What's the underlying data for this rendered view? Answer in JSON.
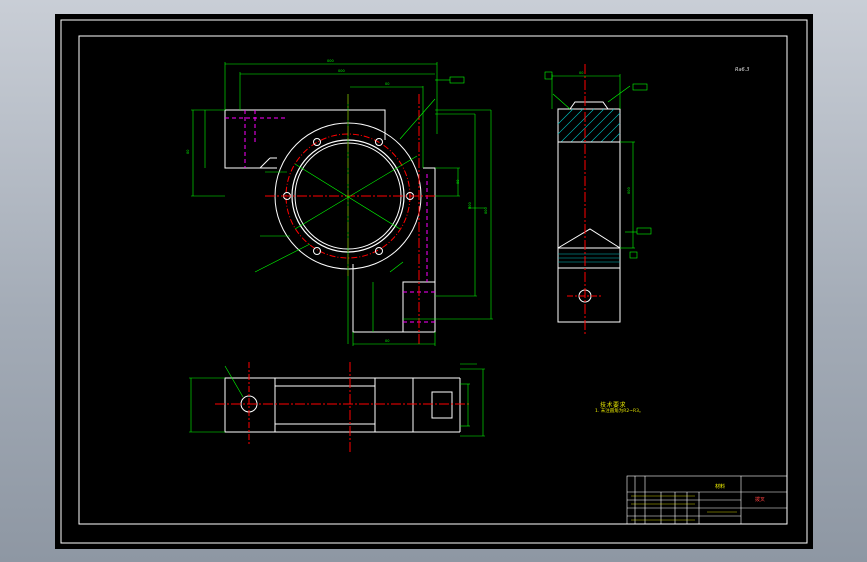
{
  "drawing": {
    "notes_title": "技术要求",
    "notes_line": "1. 未注圆角为R2~R3。",
    "sheet_ref": "Ra6.3",
    "title_block": {
      "center_title": "材料",
      "part_name": "拨叉"
    }
  },
  "colors": {
    "background_frame": "#a4acb7",
    "sheet": "#000000",
    "border": "#ffffff",
    "outline": "#ffffff",
    "dimension": "#00ff00",
    "centerline": "#ff0000",
    "hidden": "#ff00ff",
    "hatch": "#00c0c0",
    "text": "#ffff00"
  }
}
